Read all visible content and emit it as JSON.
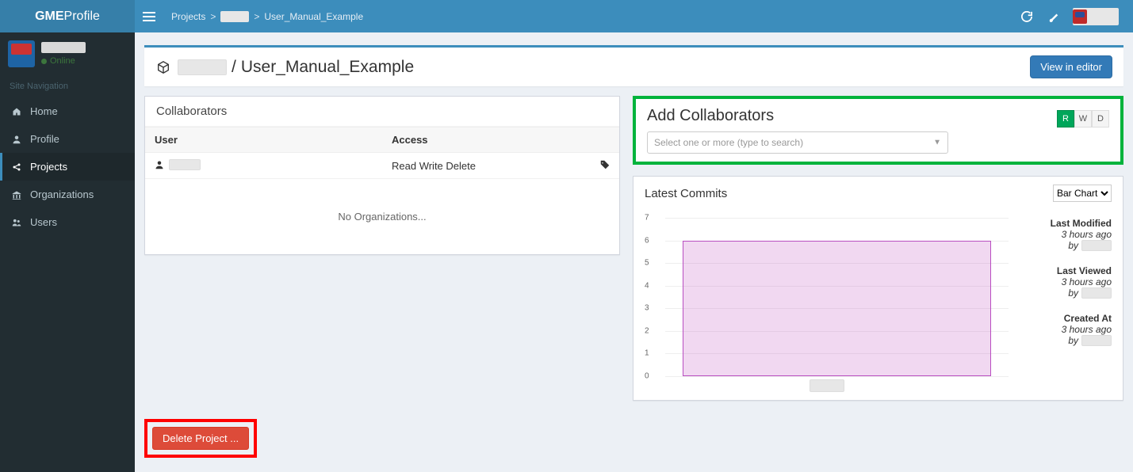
{
  "app": {
    "name_bold": "GME",
    "name_thin": "Profile"
  },
  "breadcrumb": {
    "root": "Projects",
    "owner_redacted": true,
    "leaf": "User_Manual_Example"
  },
  "sidebar": {
    "user": {
      "name_redacted": true,
      "status": "Online"
    },
    "heading": "Site Navigation",
    "items": [
      {
        "label": "Home",
        "icon": "home-icon"
      },
      {
        "label": "Profile",
        "icon": "user-icon"
      },
      {
        "label": "Projects",
        "icon": "share-icon"
      },
      {
        "label": "Organizations",
        "icon": "institution-icon"
      },
      {
        "label": "Users",
        "icon": "users-icon"
      }
    ],
    "active_index": 2
  },
  "title": {
    "owner_redacted": true,
    "sep": "/",
    "project": "User_Manual_Example"
  },
  "buttons": {
    "view_in_editor": "View in editor",
    "delete_project": "Delete Project ..."
  },
  "collaborators": {
    "heading": "Collaborators",
    "columns": {
      "user": "User",
      "access": "Access"
    },
    "rows": [
      {
        "user_redacted": true,
        "access": "Read Write Delete",
        "has_tag": true
      }
    ],
    "no_org_text": "No Organizations..."
  },
  "add_collab": {
    "heading": "Add Collaborators",
    "placeholder": "Select one or more (type to search)",
    "perms": {
      "r": "R",
      "w": "W",
      "d": "D"
    },
    "selected": "R"
  },
  "commits": {
    "heading": "Latest Commits",
    "chart_selector": {
      "options": [
        "Bar Chart"
      ],
      "selected": "Bar Chart"
    },
    "side": {
      "last_modified": {
        "label": "Last Modified",
        "when": "3 hours ago",
        "by_prefix": "by"
      },
      "last_viewed": {
        "label": "Last Viewed",
        "when": "3 hours ago",
        "by_prefix": "by"
      },
      "created_at": {
        "label": "Created At",
        "when": "3 hours ago",
        "by_prefix": "by"
      }
    }
  },
  "chart_data": {
    "type": "bar",
    "categories": [
      ""
    ],
    "values": [
      6
    ],
    "ylim": [
      0,
      7
    ],
    "yticks": [
      0,
      1,
      2,
      3,
      4,
      5,
      6,
      7
    ],
    "title": "",
    "xlabel": "",
    "ylabel": ""
  }
}
